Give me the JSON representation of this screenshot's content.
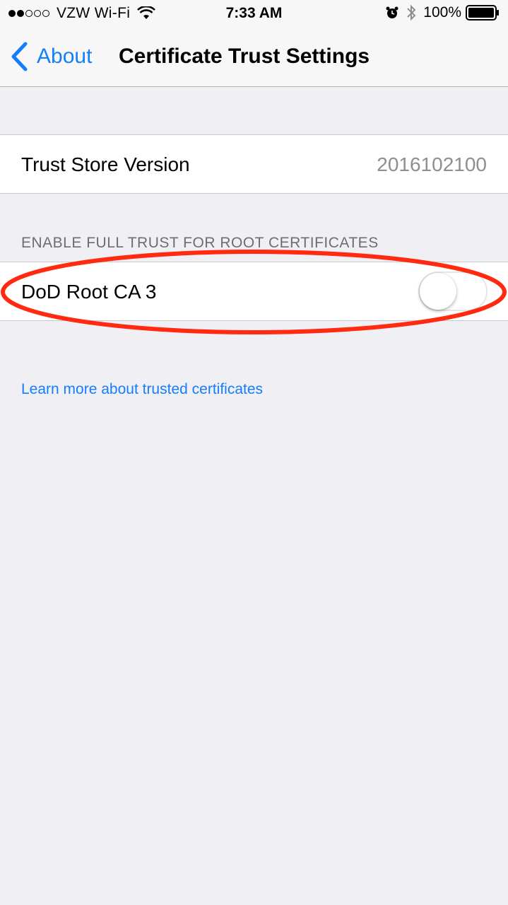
{
  "status_bar": {
    "carrier": "VZW Wi-Fi",
    "signal_bars_filled": 2,
    "signal_bars_total": 5,
    "time": "7:33 AM",
    "battery_percent": "100%",
    "icons": [
      "signal-dots-icon",
      "wifi-icon",
      "alarm-icon",
      "bluetooth-icon",
      "battery-icon"
    ]
  },
  "nav": {
    "back_label": "About",
    "title": "Certificate Trust Settings"
  },
  "trust_store": {
    "label": "Trust Store Version",
    "value": "2016102100"
  },
  "full_trust_section": {
    "header": "ENABLE FULL TRUST FOR ROOT CERTIFICATES",
    "items": [
      {
        "label": "DoD Root CA 3",
        "enabled": false
      }
    ]
  },
  "footer": {
    "link_text": "Learn more about trusted certificates"
  },
  "colors": {
    "accent": "#157efb",
    "background": "#efeff4",
    "annotation": "#ff2a10"
  }
}
